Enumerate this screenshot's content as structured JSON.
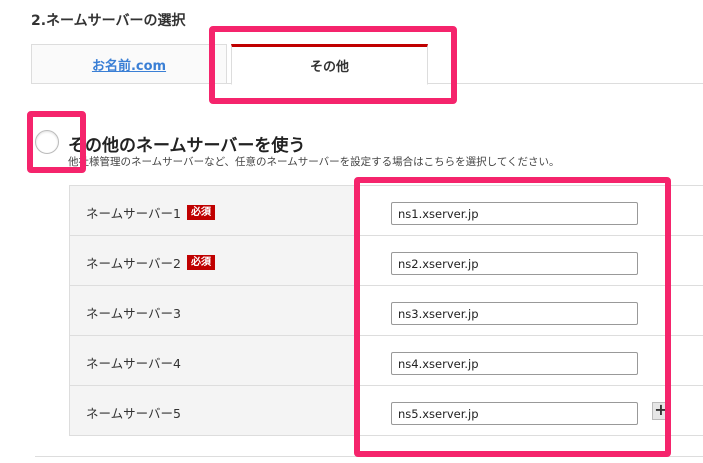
{
  "section": {
    "title": "2.ネームサーバーの選択"
  },
  "tabs": [
    {
      "label": "お名前.com"
    },
    {
      "label": "その他"
    }
  ],
  "option": {
    "title": "その他のネームサーバーを使う",
    "description": "他社様管理のネームサーバーなど、任意のネームサーバーを設定する場合はこちらを選択してください。"
  },
  "required_label": "必須",
  "nameservers": [
    {
      "label": "ネームサーバー1",
      "value": "ns1.xserver.jp"
    },
    {
      "label": "ネームサーバー2",
      "value": "ns2.xserver.jp"
    },
    {
      "label": "ネームサーバー3",
      "value": "ns3.xserver.jp"
    },
    {
      "label": "ネームサーバー4",
      "value": "ns4.xserver.jp"
    },
    {
      "label": "ネームサーバー5",
      "value": "ns5.xserver.jp"
    }
  ],
  "add_button": "+",
  "colors": {
    "highlight": "#f5246c",
    "accent": "#c00000",
    "link": "#3a7fd5"
  }
}
